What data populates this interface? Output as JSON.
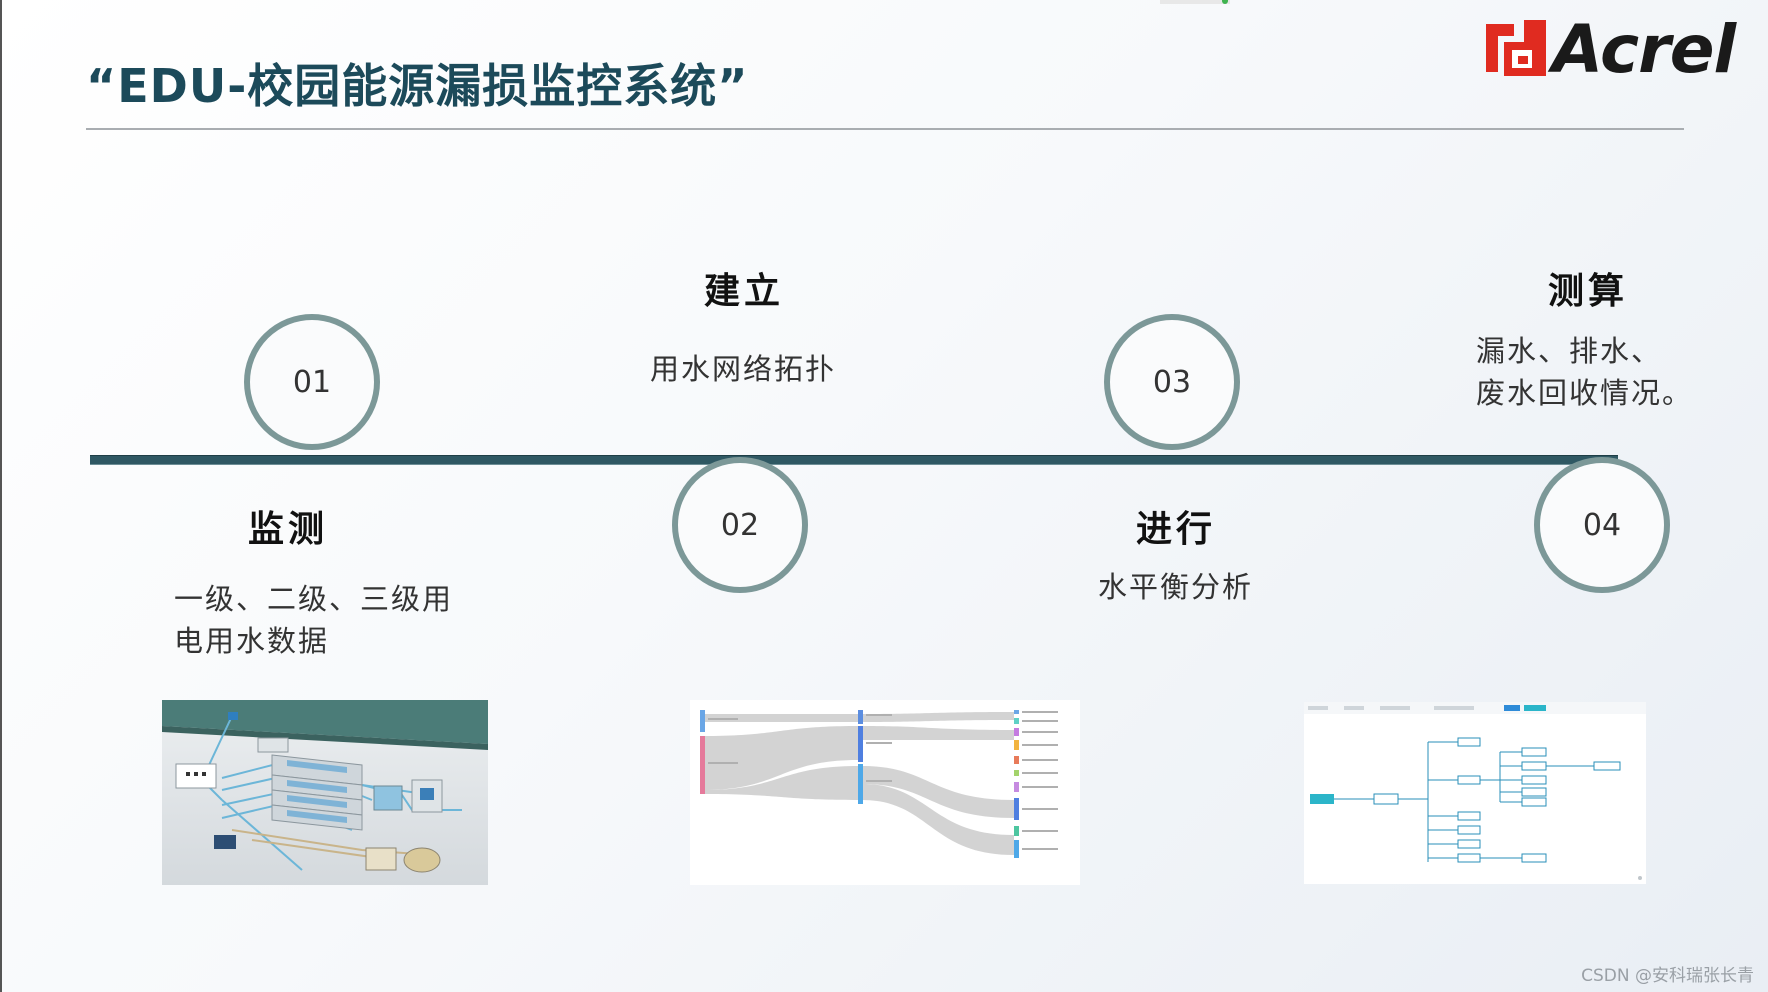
{
  "title": "“EDU-校园能源漏损监控系统”",
  "logo": {
    "text": "Acrel",
    "accent_color": "#e02b20"
  },
  "steps": [
    {
      "number": "01",
      "heading": "监测",
      "desc_lines": [
        "一级、二级、三级用",
        "电用水数据"
      ]
    },
    {
      "number": "02",
      "heading": "建立",
      "desc_lines": [
        "用水网络拓扑"
      ]
    },
    {
      "number": "03",
      "heading": "进行",
      "desc_lines": [
        "水平衡分析"
      ]
    },
    {
      "number": "04",
      "heading": "测算",
      "desc_lines": [
        "漏水、排水、",
        "废水回收情况。"
      ]
    }
  ],
  "watermark": "CSDN @安科瑞张长青",
  "colors": {
    "title": "#1c4a5a",
    "timeline": "#2f5863",
    "circle_border": "#7c9898"
  }
}
